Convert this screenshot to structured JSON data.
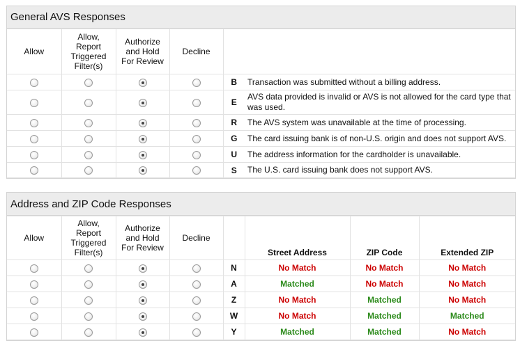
{
  "general": {
    "title": "General AVS Responses",
    "headers": [
      "Allow",
      "Allow, Report Triggered Filter(s)",
      "Authorize and Hold For Review",
      "Decline"
    ],
    "rows": [
      {
        "code": "B",
        "description": "Transaction was submitted without a billing address.",
        "selected": 2
      },
      {
        "code": "E",
        "description": "AVS data provided is invalid or AVS is not allowed for the card type that was used.",
        "selected": 2
      },
      {
        "code": "R",
        "description": "The AVS system was unavailable at the time of processing.",
        "selected": 2
      },
      {
        "code": "G",
        "description": "The card issuing bank is of non-U.S. origin and does not support AVS.",
        "selected": 2
      },
      {
        "code": "U",
        "description": "The address information for the cardholder is unavailable.",
        "selected": 2
      },
      {
        "code": "S",
        "description": "The U.S. card issuing bank does not support AVS.",
        "selected": 2
      }
    ]
  },
  "address": {
    "title": "Address and ZIP Code Responses",
    "headers": [
      "Allow",
      "Allow, Report Triggered Filter(s)",
      "Authorize and Hold For Review",
      "Decline"
    ],
    "result_headers": [
      "Street Address",
      "ZIP Code",
      "Extended ZIP"
    ],
    "rows": [
      {
        "code": "N",
        "selected": 2,
        "street": "No Match",
        "zip": "No Match",
        "ext": "No Match"
      },
      {
        "code": "A",
        "selected": 2,
        "street": "Matched",
        "zip": "No Match",
        "ext": "No Match"
      },
      {
        "code": "Z",
        "selected": 2,
        "street": "No Match",
        "zip": "Matched",
        "ext": "No Match"
      },
      {
        "code": "W",
        "selected": 2,
        "street": "No Match",
        "zip": "Matched",
        "ext": "Matched"
      },
      {
        "code": "Y",
        "selected": 2,
        "street": "Matched",
        "zip": "Matched",
        "ext": "No Match"
      }
    ]
  },
  "colors": {
    "matched": "#2b8a1a",
    "no_match": "#cc0000",
    "title_bg": "#ececec"
  }
}
